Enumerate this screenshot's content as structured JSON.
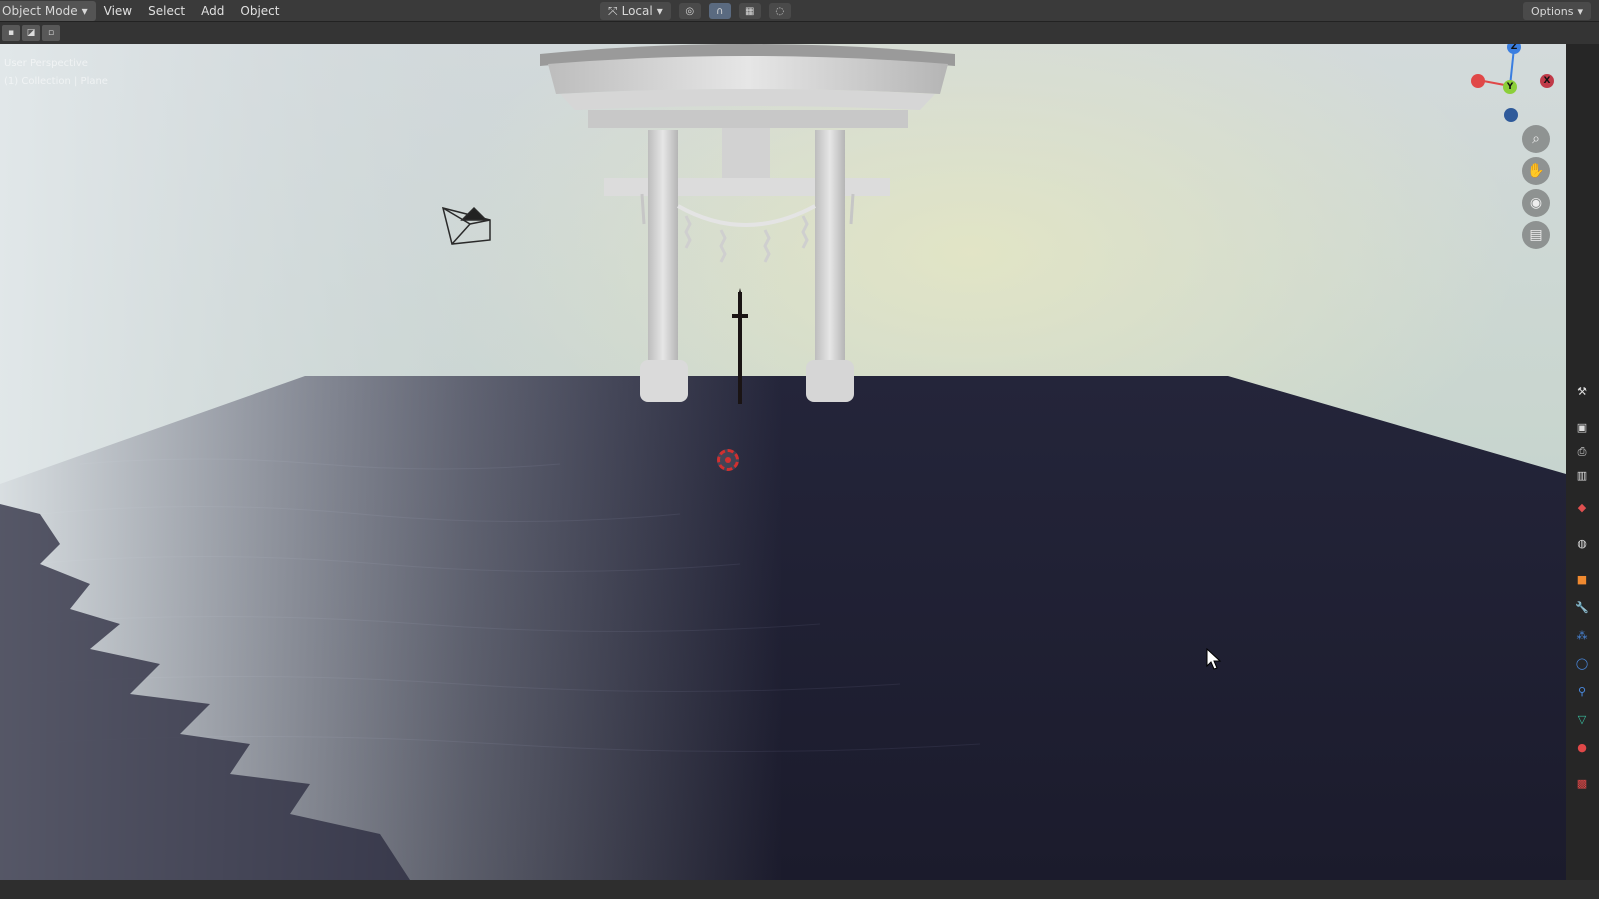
{
  "header": {
    "mode_label": "Object Mode",
    "menus": [
      "View",
      "Select",
      "Add",
      "Object"
    ],
    "pivot_label": "Local",
    "options_label": "Options"
  },
  "viewport": {
    "overlay_line1": "User Perspective",
    "overlay_line2": "(1) Collection | Plane",
    "gizmo": {
      "z": "Z",
      "y": "Y",
      "x": "X"
    }
  },
  "colors": {
    "header_bg": "#3a3a3a",
    "sky_top": "#d6dde0",
    "water": "#1f1f33",
    "cursor_red": "#d03030",
    "gizmo_x": "#e04848",
    "gizmo_y": "#8ccf3a",
    "gizmo_z": "#3a7ee0"
  },
  "icons": {
    "nav": [
      "zoom-icon",
      "pan-hand-icon",
      "camera-view-icon",
      "grid-view-icon"
    ],
    "properties": [
      "tool-icon",
      "render-icon",
      "output-icon",
      "view-layer-icon",
      "scene-icon",
      "world-icon",
      "object-icon",
      "modifier-icon",
      "particles-icon",
      "physics-icon",
      "constraints-icon",
      "data-icon",
      "material-icon",
      "texture-icon"
    ]
  }
}
